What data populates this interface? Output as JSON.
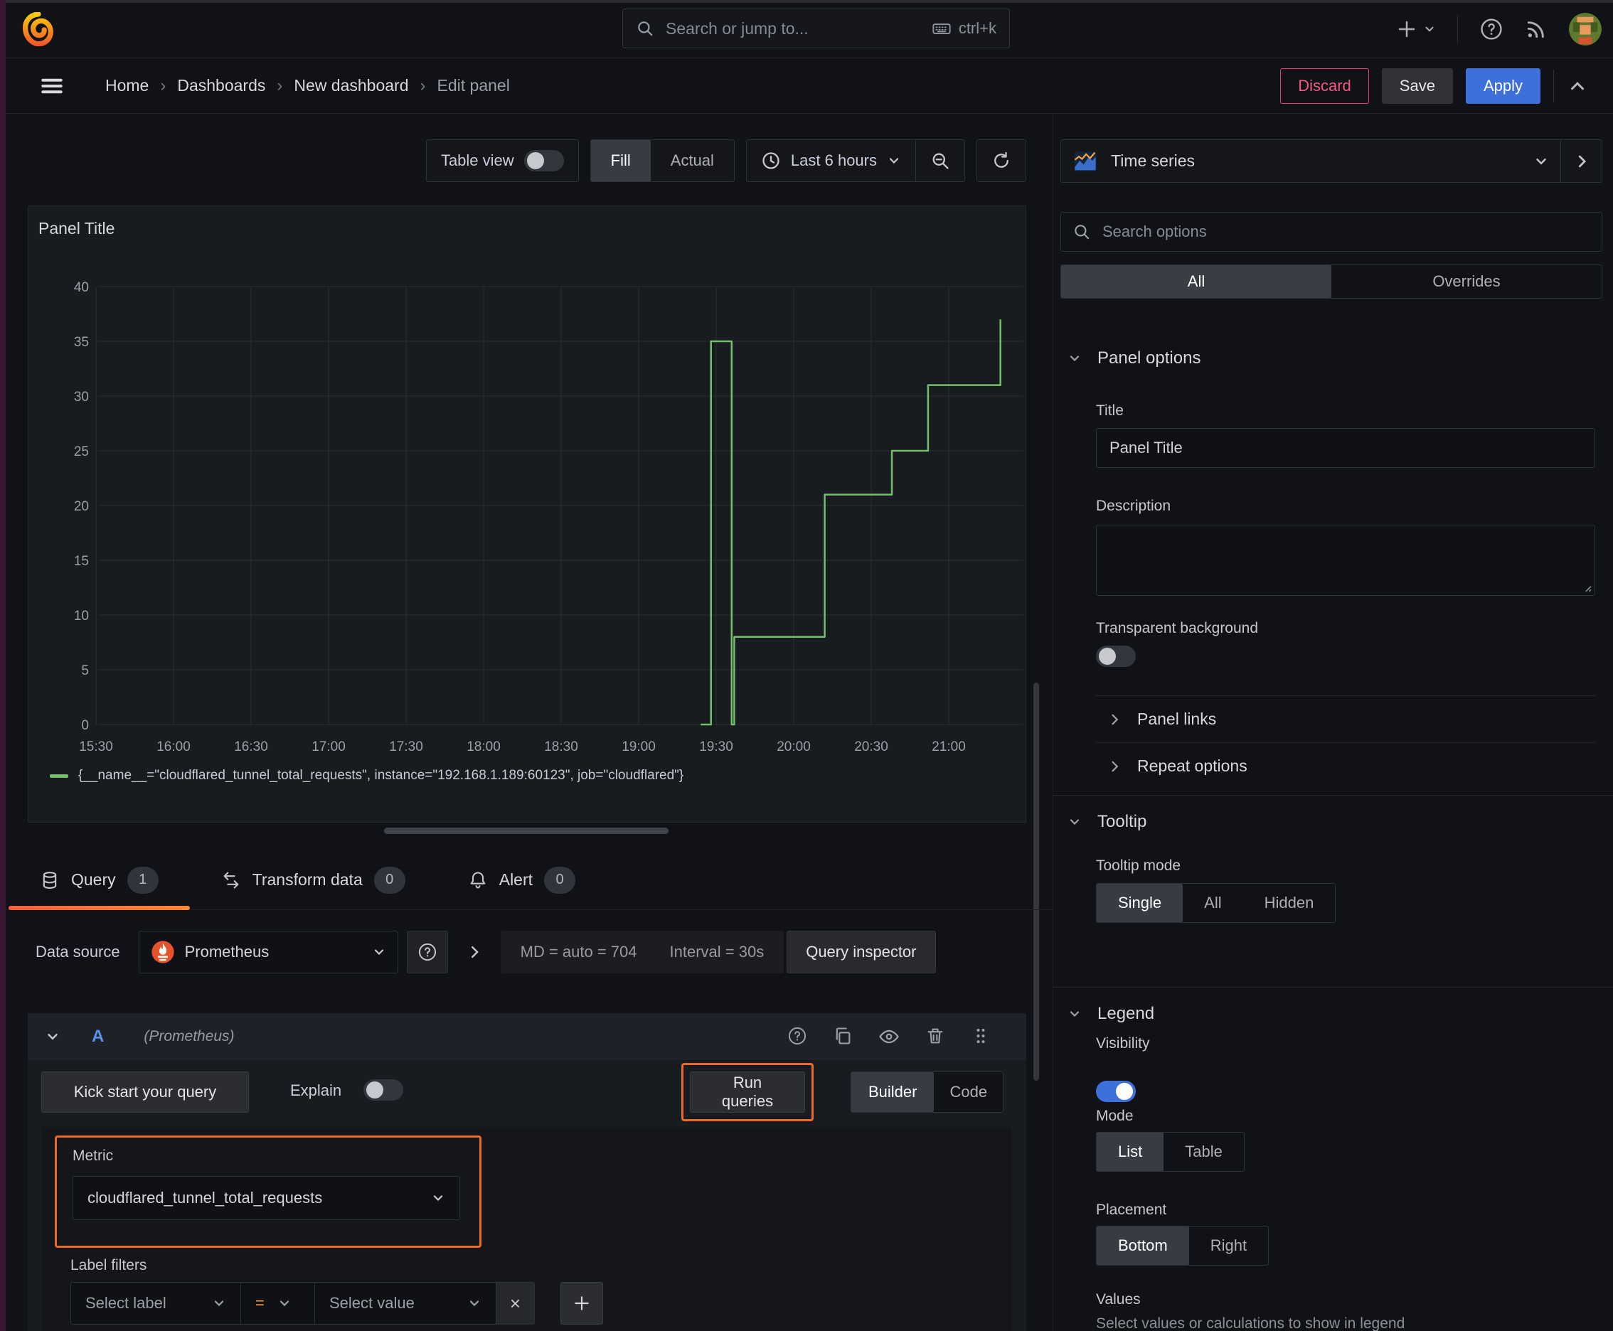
{
  "topbar": {
    "search_placeholder": "Search or jump to...",
    "shortcut": "ctrl+k"
  },
  "breadcrumb": {
    "items": [
      "Home",
      "Dashboards",
      "New dashboard",
      "Edit panel"
    ]
  },
  "actions": {
    "discard": "Discard",
    "save": "Save",
    "apply": "Apply"
  },
  "toolbar": {
    "table_view": "Table view",
    "fill": "Fill",
    "actual": "Actual",
    "time_range": "Last 6 hours"
  },
  "panel": {
    "title": "Panel Title"
  },
  "chart_data": {
    "type": "line",
    "line_interpolation": "step-after",
    "title": "Panel Title",
    "x_ticks": [
      "15:30",
      "16:00",
      "16:30",
      "17:00",
      "17:30",
      "18:00",
      "18:30",
      "19:00",
      "19:30",
      "20:00",
      "20:30",
      "21:00"
    ],
    "y_ticks": [
      0,
      5,
      10,
      15,
      20,
      25,
      30,
      35,
      40
    ],
    "ylim": [
      0,
      40
    ],
    "x_start": "15:19",
    "x_end": "21:29",
    "grid": true,
    "legend_position": "bottom",
    "series": [
      {
        "name": "{__name__=\"cloudflared_tunnel_total_requests\", instance=\"192.168.1.189:60123\", job=\"cloudflared\"}",
        "color": "#73BF69",
        "step_points": [
          [
            "19:24",
            0
          ],
          [
            "19:28",
            35
          ],
          [
            "19:36",
            0
          ],
          [
            "19:37",
            8
          ],
          [
            "20:12",
            21
          ],
          [
            "20:38",
            25
          ],
          [
            "20:52",
            31
          ],
          [
            "21:20",
            37
          ]
        ]
      }
    ]
  },
  "tabs": {
    "query": "Query",
    "query_count": "1",
    "transform": "Transform data",
    "transform_count": "0",
    "alert": "Alert",
    "alert_count": "0"
  },
  "datasource": {
    "label": "Data source",
    "name": "Prometheus",
    "md": "MD = auto = 704",
    "interval": "Interval = 30s",
    "inspector": "Query inspector"
  },
  "query": {
    "ref": "A",
    "hint": "(Prometheus)",
    "kickstart": "Kick start your query",
    "explain": "Explain",
    "run": "Run queries",
    "builder": "Builder",
    "code": "Code",
    "metric_label": "Metric",
    "metric_value": "cloudflared_tunnel_total_requests",
    "label_filters": "Label filters",
    "select_label": "Select label",
    "op": "=",
    "select_value": "Select value",
    "close": "×"
  },
  "sidebar": {
    "viz": "Time series",
    "search_placeholder": "Search options",
    "tabs": {
      "all": "All",
      "overrides": "Overrides"
    },
    "panel_options": {
      "header": "Panel options",
      "title_label": "Title",
      "title_value": "Panel Title",
      "description_label": "Description",
      "transparent_label": "Transparent background"
    },
    "links": {
      "panel_links": "Panel links",
      "repeat_options": "Repeat options"
    },
    "tooltip": {
      "header": "Tooltip",
      "mode_label": "Tooltip mode",
      "single": "Single",
      "all": "All",
      "hidden": "Hidden"
    },
    "legend": {
      "header": "Legend",
      "visibility": "Visibility",
      "mode": "Mode",
      "list": "List",
      "table": "Table",
      "placement": "Placement",
      "bottom": "Bottom",
      "right": "Right",
      "values": "Values",
      "values_desc": "Select values or calculations to show in legend"
    }
  },
  "colors": {
    "series_green": "#73BF69",
    "accent_blue": "#3d71d9",
    "highlight_orange": "#eb6a2a",
    "discard_pink": "#ee3d70",
    "tab_accent": "#ff780a"
  }
}
